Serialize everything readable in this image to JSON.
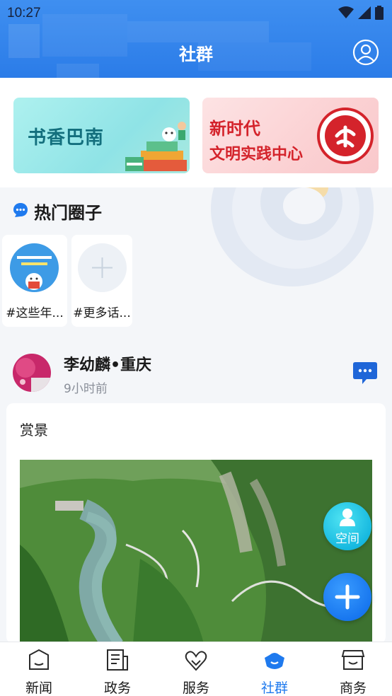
{
  "status_bar": {
    "time": "10:27"
  },
  "header": {
    "title": "社群"
  },
  "banners": [
    {
      "text": "书香巴南"
    },
    {
      "line1": "新时代",
      "line2": "文明实践中心"
    }
  ],
  "hot_circles": {
    "title": "热门圈子",
    "items": [
      {
        "label": "#这些年..."
      },
      {
        "label": "#更多话..."
      }
    ]
  },
  "post": {
    "author": "李幼麟•重庆",
    "time": "9小时前",
    "text": "赏景"
  },
  "fab": {
    "space_label": "空间"
  },
  "tabbar": {
    "tabs": [
      {
        "label": "新闻",
        "icon": "news-icon"
      },
      {
        "label": "政务",
        "icon": "government-icon"
      },
      {
        "label": "服务",
        "icon": "service-icon"
      },
      {
        "label": "社群",
        "icon": "community-icon",
        "active": true
      },
      {
        "label": "商务",
        "icon": "shop-icon"
      }
    ]
  },
  "colors": {
    "primary": "#2b7ce8",
    "active_tab": "#1f7aee",
    "fab_space": "#17b9e0",
    "fab_add": "#1877ef"
  }
}
